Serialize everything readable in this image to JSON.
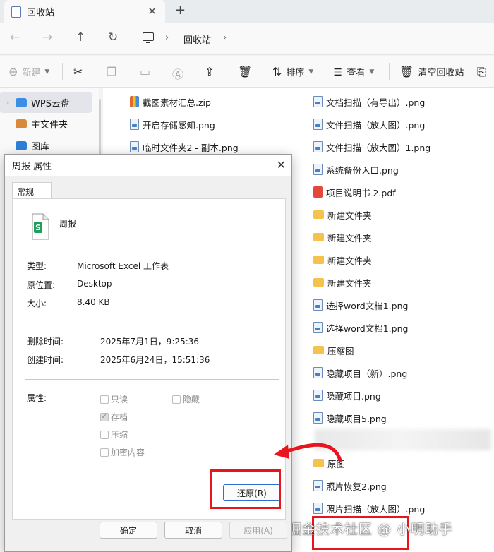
{
  "window": {
    "tab_title": "回收站",
    "tab_close": "✕",
    "tab_add": "+"
  },
  "nav": {
    "back": "←",
    "forward": "→",
    "up": "↑",
    "refresh": "↻",
    "chevron": "›",
    "breadcrumb": [
      "回收站"
    ]
  },
  "toolbar": {
    "new_label": "新建",
    "sort_label": "排序",
    "view_label": "查看",
    "empty_recycle_label": "清空回收站"
  },
  "sidebar": {
    "items": [
      {
        "label": "WPS云盘",
        "icon": "cloud-icon"
      },
      {
        "label": "主文件夹",
        "icon": "home-icon"
      },
      {
        "label": "图库",
        "icon": "gallery-icon"
      }
    ]
  },
  "files": {
    "left_column": [
      {
        "name": "截图素材汇总.zip",
        "type": "zip"
      },
      {
        "name": "开启存储感知.png",
        "type": "png"
      },
      {
        "name": "临时文件夹2 - 副本.png",
        "type": "png"
      }
    ],
    "right_column": [
      {
        "name": "文档扫描（有导出）.png",
        "type": "png"
      },
      {
        "name": "文件扫描（放大图）.png",
        "type": "png"
      },
      {
        "name": "文件扫描（放大图）1.png",
        "type": "png"
      },
      {
        "name": "系统备份入口.png",
        "type": "png"
      },
      {
        "name": "项目说明书 2.pdf",
        "type": "pdf"
      },
      {
        "name": "新建文件夹",
        "type": "folder"
      },
      {
        "name": "新建文件夹",
        "type": "folder"
      },
      {
        "name": "新建文件夹",
        "type": "folder"
      },
      {
        "name": "新建文件夹",
        "type": "folder"
      },
      {
        "name": "选择word文档1.png",
        "type": "png"
      },
      {
        "name": "选择word文档1.png",
        "type": "png"
      },
      {
        "name": "压缩图",
        "type": "folder"
      },
      {
        "name": "隐藏项目（新）.png",
        "type": "png"
      },
      {
        "name": "隐藏项目.png",
        "type": "png"
      },
      {
        "name": "隐藏项目5.png",
        "type": "png"
      },
      {
        "name": "",
        "type": "blurred"
      },
      {
        "name": "原图",
        "type": "folder"
      },
      {
        "name": "照片恢复2.png",
        "type": "png"
      },
      {
        "name": "照片扫描（放大图）.png",
        "type": "png"
      }
    ]
  },
  "dialog": {
    "title": "周报 属性",
    "close": "✕",
    "tab": "常规",
    "file_name": "周报",
    "type_label": "类型:",
    "type_value": "Microsoft Excel 工作表",
    "origin_label": "原位置:",
    "origin_value": "Desktop",
    "size_label": "大小:",
    "size_value": "8.40 KB",
    "deleted_label": "删除时间:",
    "deleted_value": "2025年7月1日，9:25:36",
    "created_label": "创建时间:",
    "created_value": "2025年6月24日，15:51:36",
    "attrs_label": "属性:",
    "attrs": {
      "readonly": {
        "label": "只读",
        "checked": false
      },
      "hidden": {
        "label": "隐藏",
        "checked": false
      },
      "archive": {
        "label": "存档",
        "checked": true
      },
      "compress": {
        "label": "压缩",
        "checked": false
      },
      "encrypt": {
        "label": "加密内容",
        "checked": false
      }
    },
    "restore_button": "还原(R)",
    "ok_button": "确定",
    "cancel_button": "取消",
    "apply_button": "应用(A)"
  },
  "watermark": "掘金技术社区 @ 小明助手",
  "colors": {
    "highlight": "#e8141e",
    "accent": "#2e6fd0",
    "folder": "#f4c24d",
    "excel": "#1e9e5a"
  }
}
